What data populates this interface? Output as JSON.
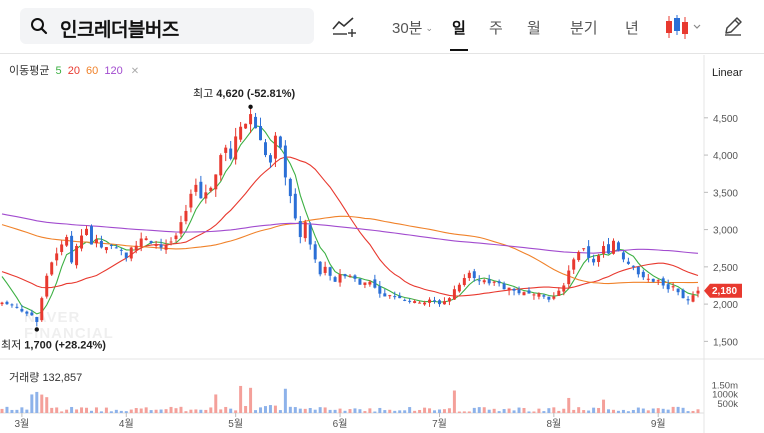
{
  "header": {
    "stock_name": "인크레더블버즈",
    "interval_label": "30분",
    "periods": [
      {
        "label": "일",
        "active": true
      },
      {
        "label": "주",
        "active": false
      },
      {
        "label": "월",
        "active": false
      },
      {
        "label": "분기",
        "active": false
      },
      {
        "label": "년",
        "active": false
      }
    ],
    "scale_label": "Linear"
  },
  "legend": {
    "ma_title": "이동평균",
    "ma_items": [
      {
        "label": "5",
        "color": "#3cb043"
      },
      {
        "label": "20",
        "color": "#e8392f"
      },
      {
        "label": "60",
        "color": "#f0822a"
      },
      {
        "label": "120",
        "color": "#a24ccf"
      }
    ],
    "volume_title": "거래량",
    "volume_value": "132,857"
  },
  "watermark": [
    "NAVER",
    "FINANCIAL"
  ],
  "chart_data": {
    "type": "candlestick",
    "up_color": "#e8392f",
    "down_color": "#2b6fd6",
    "ylim": [
      1250,
      4900
    ],
    "y_ticks": [
      {
        "value": 1500,
        "label": "1,500"
      },
      {
        "value": 2000,
        "label": "2,000"
      },
      {
        "value": 2500,
        "label": "2,500"
      },
      {
        "value": 3000,
        "label": "3,000"
      },
      {
        "value": 3500,
        "label": "3,500"
      },
      {
        "value": 4000,
        "label": "4,000"
      },
      {
        "value": 4500,
        "label": "4,500"
      }
    ],
    "x_ticks": [
      {
        "index": 4,
        "label": "3월"
      },
      {
        "index": 25,
        "label": "4월"
      },
      {
        "index": 47,
        "label": "5월"
      },
      {
        "index": 68,
        "label": "6월"
      },
      {
        "index": 88,
        "label": "7월"
      },
      {
        "index": 111,
        "label": "8월"
      },
      {
        "index": 132,
        "label": "9월"
      }
    ],
    "last_price": {
      "value": 2180,
      "label": "2,180",
      "color": "#e8392f"
    },
    "annotations": {
      "high": {
        "index": 50,
        "value": 4620,
        "prefix": "최고",
        "value_label": "4,620",
        "change": "(-52.81%)"
      },
      "low": {
        "index": 7,
        "value": 1700,
        "prefix": "최저",
        "value_label": "1,700",
        "change": "(+28.24%)"
      }
    },
    "volume_ticks": [
      {
        "value": 1500000,
        "label": "1.50m"
      },
      {
        "value": 1000000,
        "label": "1000k"
      },
      {
        "value": 500000,
        "label": "500k"
      }
    ],
    "volume_max": 1750000,
    "anchors": [
      [
        0,
        2020
      ],
      [
        3,
        1960
      ],
      [
        6,
        1850
      ],
      [
        7,
        1760
      ],
      [
        8,
        2080
      ],
      [
        9,
        2380
      ],
      [
        10,
        2560
      ],
      [
        11,
        2680
      ],
      [
        12,
        2800
      ],
      [
        13,
        2900
      ],
      [
        14,
        2560
      ],
      [
        15,
        2780
      ],
      [
        16,
        2920
      ],
      [
        17,
        3010
      ],
      [
        18,
        2800
      ],
      [
        19,
        2870
      ],
      [
        20,
        2760
      ],
      [
        22,
        2780
      ],
      [
        24,
        2720
      ],
      [
        25,
        2620
      ],
      [
        26,
        2760
      ],
      [
        28,
        2880
      ],
      [
        30,
        2820
      ],
      [
        32,
        2760
      ],
      [
        34,
        2840
      ],
      [
        35,
        2920
      ],
      [
        36,
        3100
      ],
      [
        37,
        3250
      ],
      [
        38,
        3480
      ],
      [
        39,
        3600
      ],
      [
        40,
        3420
      ],
      [
        41,
        3500
      ],
      [
        42,
        3560
      ],
      [
        43,
        3740
      ],
      [
        44,
        4000
      ],
      [
        45,
        4100
      ],
      [
        46,
        3950
      ],
      [
        47,
        4250
      ],
      [
        48,
        4380
      ],
      [
        49,
        4420
      ],
      [
        50,
        4550
      ],
      [
        51,
        4360
      ],
      [
        52,
        4200
      ],
      [
        53,
        4000
      ],
      [
        54,
        3900
      ],
      [
        55,
        4260
      ],
      [
        56,
        4100
      ],
      [
        57,
        3700
      ],
      [
        58,
        3450
      ],
      [
        59,
        3150
      ],
      [
        60,
        2900
      ],
      [
        61,
        3100
      ],
      [
        62,
        2800
      ],
      [
        63,
        2600
      ],
      [
        64,
        2400
      ],
      [
        65,
        2500
      ],
      [
        66,
        2380
      ],
      [
        67,
        2300
      ],
      [
        68,
        2400
      ],
      [
        70,
        2380
      ],
      [
        72,
        2260
      ],
      [
        74,
        2300
      ],
      [
        75,
        2220
      ],
      [
        76,
        2140
      ],
      [
        78,
        2120
      ],
      [
        80,
        2080
      ],
      [
        82,
        2040
      ],
      [
        84,
        2020
      ],
      [
        86,
        2060
      ],
      [
        88,
        2000
      ],
      [
        90,
        2080
      ],
      [
        91,
        2200
      ],
      [
        92,
        2260
      ],
      [
        93,
        2350
      ],
      [
        94,
        2420
      ],
      [
        95,
        2350
      ],
      [
        97,
        2320
      ],
      [
        99,
        2300
      ],
      [
        101,
        2200
      ],
      [
        103,
        2180
      ],
      [
        105,
        2160
      ],
      [
        107,
        2130
      ],
      [
        109,
        2100
      ],
      [
        110,
        2060
      ],
      [
        111,
        2100
      ],
      [
        112,
        2180
      ],
      [
        113,
        2250
      ],
      [
        114,
        2450
      ],
      [
        115,
        2600
      ],
      [
        116,
        2700
      ],
      [
        117,
        2750
      ],
      [
        118,
        2620
      ],
      [
        119,
        2560
      ],
      [
        120,
        2650
      ],
      [
        121,
        2780
      ],
      [
        122,
        2680
      ],
      [
        123,
        2850
      ],
      [
        124,
        2720
      ],
      [
        125,
        2600
      ],
      [
        126,
        2540
      ],
      [
        127,
        2500
      ],
      [
        128,
        2400
      ],
      [
        129,
        2360
      ],
      [
        130,
        2340
      ],
      [
        131,
        2300
      ],
      [
        132,
        2320
      ],
      [
        133,
        2250
      ],
      [
        134,
        2200
      ],
      [
        135,
        2240
      ],
      [
        136,
        2160
      ],
      [
        137,
        2080
      ],
      [
        138,
        2050
      ],
      [
        139,
        2120
      ],
      [
        140,
        2180
      ]
    ]
  }
}
